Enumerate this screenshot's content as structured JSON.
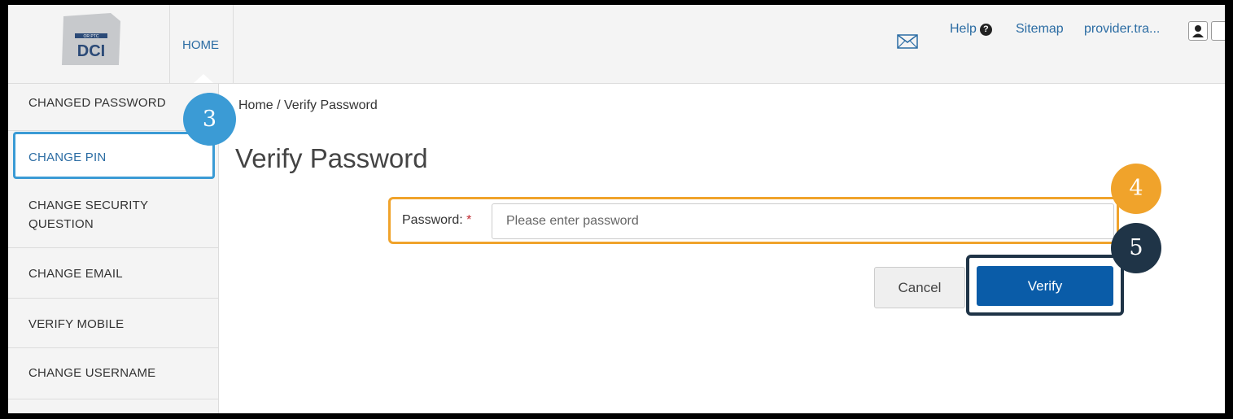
{
  "header": {
    "logo_badge": "OR PTC",
    "logo_text": "DCI",
    "nav_home": "HOME",
    "help": "Help",
    "help_icon": "?",
    "sitemap": "Sitemap",
    "user": "provider.tra..."
  },
  "sidebar": {
    "items": [
      {
        "label": "CHANGED PASSWORD"
      },
      {
        "label": "CHANGE PIN"
      },
      {
        "label_line1": "CHANGE SECURITY",
        "label_line2": "QUESTION"
      },
      {
        "label": "CHANGE EMAIL"
      },
      {
        "label": "VERIFY MOBILE"
      },
      {
        "label": "CHANGE USERNAME"
      }
    ]
  },
  "main": {
    "breadcrumb": "Home / Verify Password",
    "title": "Verify Password",
    "password_label": "Password:",
    "required_mark": "*",
    "password_placeholder": "Please enter password",
    "password_value": "",
    "cancel_label": "Cancel",
    "verify_label": "Verify"
  },
  "callouts": [
    "3",
    "4",
    "5"
  ],
  "colors": {
    "link": "#2b6ca3",
    "callout_3": "#3b9bd5",
    "callout_4": "#f0a32b",
    "callout_5": "#1f3447",
    "verify_button": "#0a5ca8"
  },
  "icons": [
    "mail-icon",
    "help-icon",
    "user-icon"
  ]
}
